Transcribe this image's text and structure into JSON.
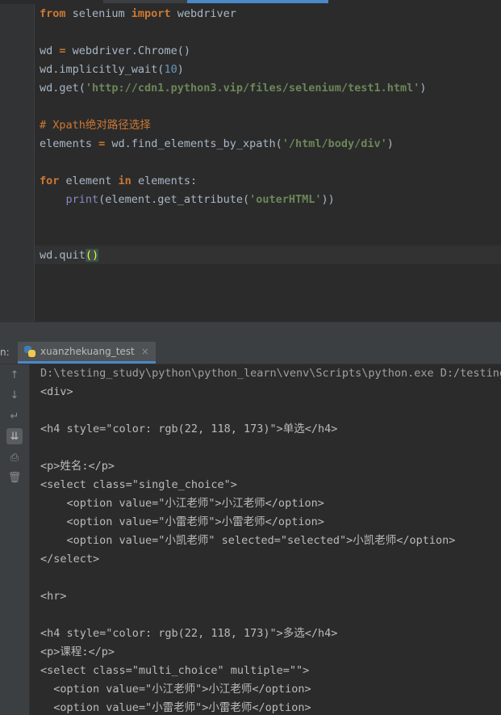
{
  "editor": {
    "lines": [
      {
        "parts": [
          {
            "t": "from",
            "c": "kw"
          },
          {
            "t": " selenium ",
            "c": ""
          },
          {
            "t": "import",
            "c": "kw"
          },
          {
            "t": " webdriver",
            "c": ""
          }
        ]
      },
      {
        "parts": []
      },
      {
        "parts": [
          {
            "t": "wd ",
            "c": ""
          },
          {
            "t": "=",
            "c": "kw"
          },
          {
            "t": " webdriver.Chrome()",
            "c": ""
          }
        ]
      },
      {
        "parts": [
          {
            "t": "wd.implicitly_wait(",
            "c": ""
          },
          {
            "t": "10",
            "c": "num"
          },
          {
            "t": ")",
            "c": ""
          }
        ]
      },
      {
        "parts": [
          {
            "t": "wd.get(",
            "c": ""
          },
          {
            "t": "'http://cdn1.python3.vip/files/selenium/test1.html'",
            "c": "str"
          },
          {
            "t": ")",
            "c": ""
          }
        ]
      },
      {
        "parts": []
      },
      {
        "parts": [
          {
            "t": "# Xpath绝对路径选择",
            "c": "cmt"
          }
        ]
      },
      {
        "parts": [
          {
            "t": "elements ",
            "c": ""
          },
          {
            "t": "=",
            "c": "kw"
          },
          {
            "t": " wd.find_elements_by_xpath(",
            "c": ""
          },
          {
            "t": "'/html/body/div'",
            "c": "str"
          },
          {
            "t": ")",
            "c": ""
          }
        ]
      },
      {
        "parts": []
      },
      {
        "parts": [
          {
            "t": "for",
            "c": "kw"
          },
          {
            "t": " element ",
            "c": ""
          },
          {
            "t": "in",
            "c": "kw"
          },
          {
            "t": " elements:",
            "c": ""
          }
        ]
      },
      {
        "parts": [
          {
            "t": "    ",
            "c": ""
          },
          {
            "t": "print",
            "c": "bi"
          },
          {
            "t": "(element.get_attribute(",
            "c": ""
          },
          {
            "t": "'outerHTML'",
            "c": "str"
          },
          {
            "t": "))",
            "c": ""
          }
        ]
      },
      {
        "parts": []
      },
      {
        "parts": []
      },
      {
        "parts": [
          {
            "t": "wd.quit",
            "c": ""
          },
          {
            "t": "()",
            "c": "paren-hl"
          }
        ]
      }
    ]
  },
  "run_panel": {
    "label": "n:",
    "tab_name": "xuanzhekuang_test",
    "close_glyph": "×"
  },
  "toolbar_icons": [
    "up-arrow-icon",
    "down-arrow-icon",
    "soft-wrap-icon",
    "scroll-to-end-icon",
    "print-icon",
    "trash-icon"
  ],
  "console": {
    "lines": [
      "D:\\testing_study\\python\\python_learn\\venv\\Scripts\\python.exe D:/testing_",
      "<div>",
      "",
      "<h4 style=\"color: rgb(22, 118, 173)\">单选</h4>",
      "",
      "<p>姓名:</p>",
      "<select class=\"single_choice\">",
      "    <option value=\"小江老师\">小江老师</option>",
      "    <option value=\"小雷老师\">小雷老师</option>",
      "    <option value=\"小凯老师\" selected=\"selected\">小凯老师</option>",
      "</select>",
      "",
      "<hr>",
      "",
      "<h4 style=\"color: rgb(22, 118, 173)\">多选</h4>",
      "<p>课程:</p>",
      "<select class=\"multi_choice\" multiple=\"\">",
      "  <option value=\"小江老师\">小江老师</option>",
      "  <option value=\"小雷老师\">小雷老师</option>"
    ]
  }
}
